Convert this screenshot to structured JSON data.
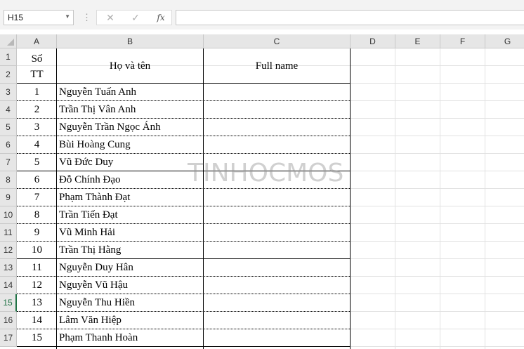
{
  "formula_bar": {
    "name_box": "H15",
    "cancel_icon": "✕",
    "enter_icon": "✓",
    "fx_label": "fx",
    "formula_value": ""
  },
  "columns": [
    "A",
    "B",
    "C",
    "D",
    "E",
    "F",
    "G"
  ],
  "rows": [
    "1",
    "2",
    "3",
    "4",
    "5",
    "6",
    "7",
    "8",
    "9",
    "10",
    "11",
    "12",
    "13",
    "14",
    "15",
    "16",
    "17"
  ],
  "active_row": "15",
  "table": {
    "header_stt_line1": "Số",
    "header_stt_line2": "TT",
    "header_name": "Họ và tên",
    "header_fullname": "Full name",
    "records": [
      {
        "stt": "1",
        "name": "Nguyễn Tuấn Anh",
        "full": ""
      },
      {
        "stt": "2",
        "name": "Trần Thị Vân Anh",
        "full": ""
      },
      {
        "stt": "3",
        "name": "Nguyễn Trần Ngọc Ánh",
        "full": ""
      },
      {
        "stt": "4",
        "name": "Bùi Hoàng Cung",
        "full": ""
      },
      {
        "stt": "5",
        "name": "Vũ Đức Duy",
        "full": ""
      },
      {
        "stt": "6",
        "name": "Đỗ Chính Đạo",
        "full": ""
      },
      {
        "stt": "7",
        "name": "Phạm Thành Đạt",
        "full": ""
      },
      {
        "stt": "8",
        "name": "Trần Tiến Đạt",
        "full": ""
      },
      {
        "stt": "9",
        "name": "Vũ Minh Hải",
        "full": ""
      },
      {
        "stt": "10",
        "name": "Trần Thị Hằng",
        "full": ""
      },
      {
        "stt": "11",
        "name": "Nguyễn Duy Hân",
        "full": ""
      },
      {
        "stt": "12",
        "name": "Nguyễn Vũ Hậu",
        "full": ""
      },
      {
        "stt": "13",
        "name": "Nguyễn Thu Hiền",
        "full": ""
      },
      {
        "stt": "14",
        "name": "Lâm Văn Hiệp",
        "full": ""
      },
      {
        "stt": "15",
        "name": "Phạm Thanh Hoàn",
        "full": ""
      }
    ]
  },
  "watermark": "TINHOCMOS"
}
